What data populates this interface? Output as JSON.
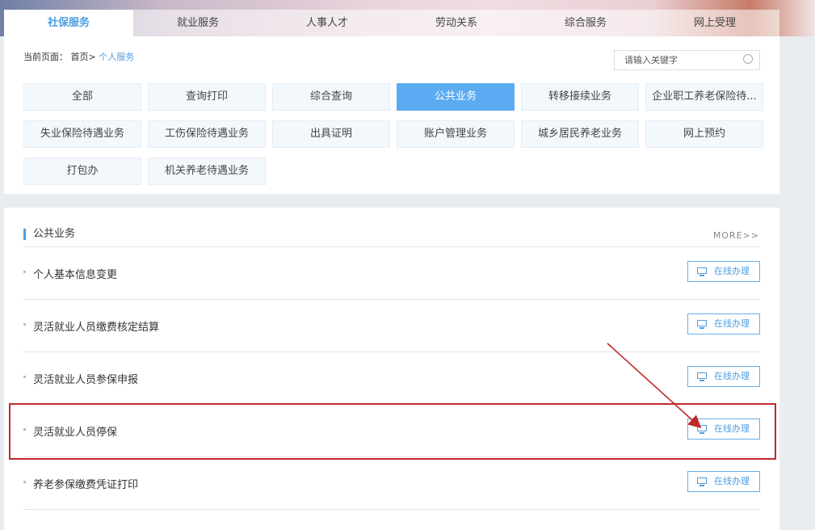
{
  "nav": {
    "tabs": [
      "社保服务",
      "就业服务",
      "人事人才",
      "劳动关系",
      "综合服务",
      "网上受理"
    ],
    "active": 0
  },
  "breadcrumb": {
    "label": "当前页面：",
    "home": "首页>",
    "current": "个人服务"
  },
  "search": {
    "placeholder": "请输入关键字"
  },
  "categories": [
    "全部",
    "查询打印",
    "综合查询",
    "公共业务",
    "转移接续业务",
    "企业职工养老保险待...",
    "失业保险待遇业务",
    "工伤保险待遇业务",
    "出具证明",
    "账户管理业务",
    "城乡居民养老业务",
    "网上预约",
    "打包办",
    "机关养老待遇业务"
  ],
  "active_category": "公共业务",
  "section": {
    "title": "公共业务",
    "more": "MORE>>",
    "button_label": "在线办理",
    "items": [
      "个人基本信息变更",
      "灵活就业人员缴费核定结算",
      "灵活就业人员参保申报",
      "灵活就业人员停保",
      "养老参保缴费凭证打印"
    ]
  },
  "colors": {
    "accent": "#4d9de0",
    "highlight": "#c0282a"
  }
}
